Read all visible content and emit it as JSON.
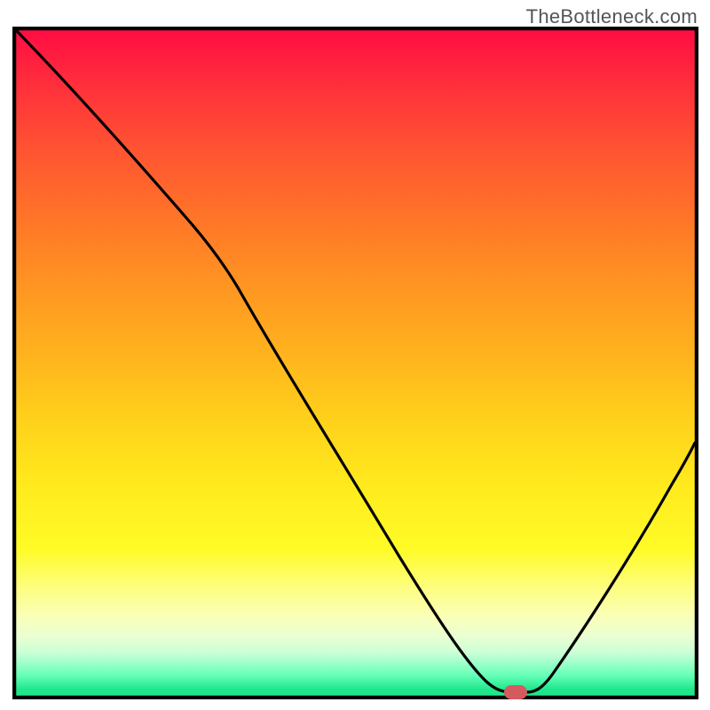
{
  "watermark": "TheBottleneck.com",
  "chart_data": {
    "type": "line",
    "title": "",
    "xlabel": "",
    "ylabel": "",
    "xlim": [
      0,
      100
    ],
    "ylim": [
      0,
      100
    ],
    "grid": false,
    "legend": false,
    "series": [
      {
        "name": "bottleneck-curve",
        "x": [
          0,
          12,
          25,
          32,
          40,
          50,
          58,
          63,
          67,
          71,
          74,
          100
        ],
        "values": [
          100,
          87,
          71,
          62,
          50,
          35,
          22,
          12,
          5,
          1,
          1,
          42
        ]
      }
    ],
    "marker": {
      "x": 72,
      "y": 0.5
    },
    "background_gradient": {
      "stops": [
        {
          "pos": 0,
          "color": "#ff0d43"
        },
        {
          "pos": 28,
          "color": "#ff7428"
        },
        {
          "pos": 58,
          "color": "#ffcf1b"
        },
        {
          "pos": 84,
          "color": "#fdfe83"
        },
        {
          "pos": 95,
          "color": "#a0ffcb"
        },
        {
          "pos": 100,
          "color": "#1fe78c"
        }
      ]
    }
  }
}
